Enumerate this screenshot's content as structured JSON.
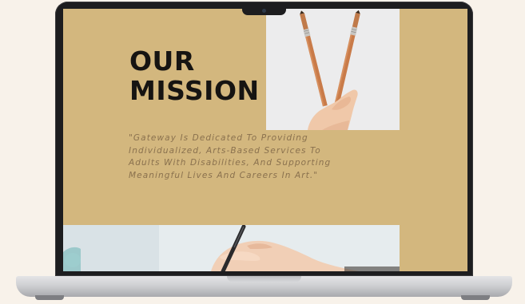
{
  "page": {
    "heading_line1": "OUR",
    "heading_line2": "MISSION",
    "mission_statement": "\"Gateway Is Dedicated To Providing Individualized, Arts-Based Services To Adults With Disabilities, And Supporting Meaningful Lives And Careers In Art.\""
  },
  "colors": {
    "background": "#d3b77e",
    "heading": "#161412",
    "quote_text": "#8a714e",
    "device_frame": "#1d1d1f"
  },
  "images": {
    "top_photo": "hand-holding-paintbrushes",
    "bottom_photo": "hand-holding-pen"
  }
}
